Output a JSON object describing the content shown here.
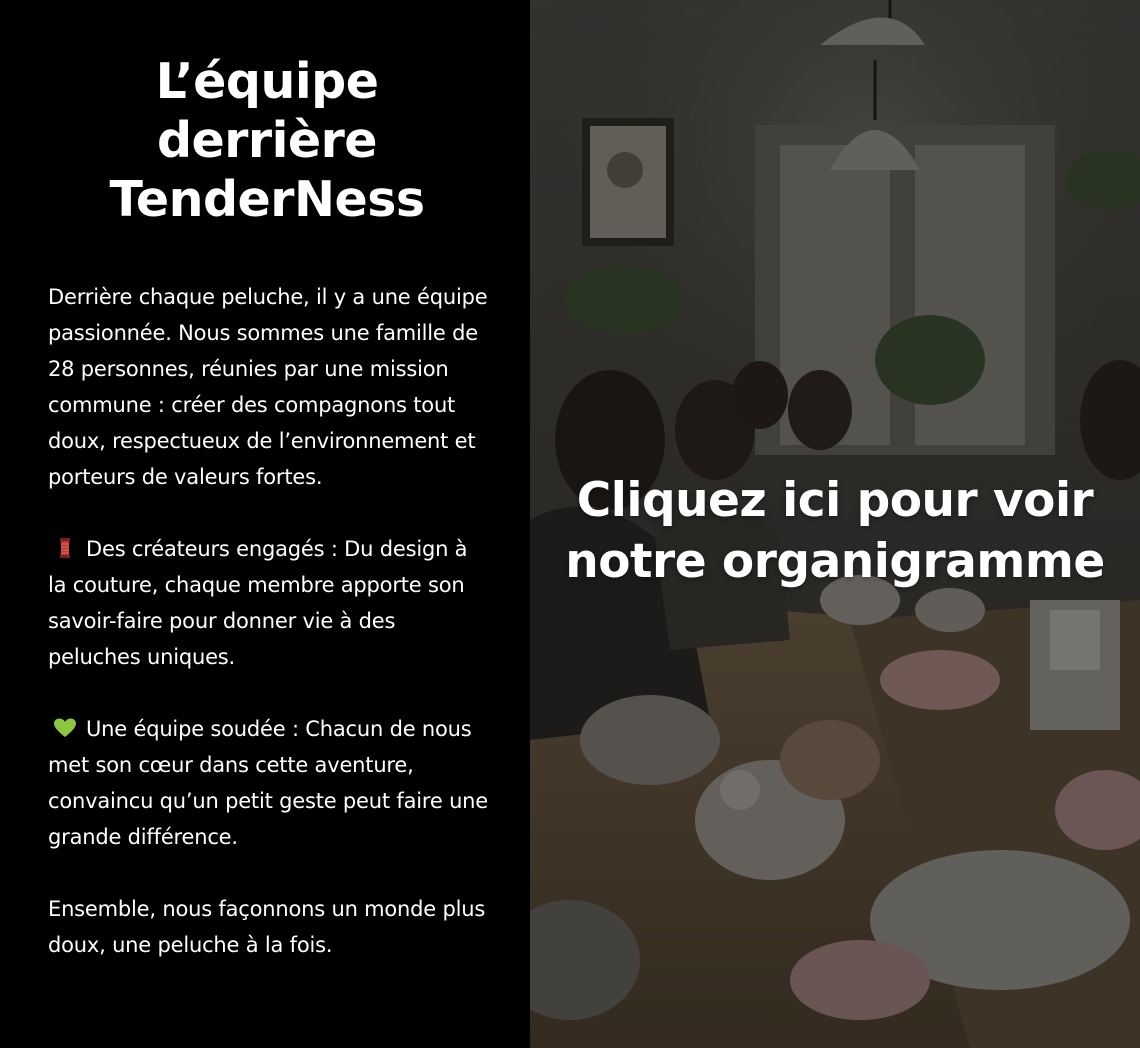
{
  "team_section": {
    "title_lines": [
      "L’équipe",
      "derrière",
      "TenderNess"
    ],
    "intro": "Derrière chaque peluche, il y a une équipe passionnée. Nous sommes une famille de 28 personnes, réunies par une mission commune : créer des compagnons tout doux, respectueux de l’environnement et porteurs de valeurs fortes.",
    "point_creators": {
      "icon": "thread-spool-icon",
      "text": "Des créateurs engagés : Du design à la couture, chaque membre apporte son savoir-faire pour donner vie à des peluches uniques."
    },
    "point_team": {
      "icon": "green-heart-icon",
      "text": "Une équipe soudée : Chacun de nous met son cœur dans cette aventure, convaincu qu’un petit geste peut faire une grande différence."
    },
    "closing": "Ensemble, nous façonnons un monde plus doux, une peluche à la fois."
  },
  "org_chart_link": {
    "line1": "Cliquez ici pour voir",
    "line2": "notre organigramme"
  },
  "colors": {
    "left_background": "#000000",
    "text": "#ffffff",
    "spool_red": "#c0392b",
    "heart_green": "#8dc63f"
  }
}
